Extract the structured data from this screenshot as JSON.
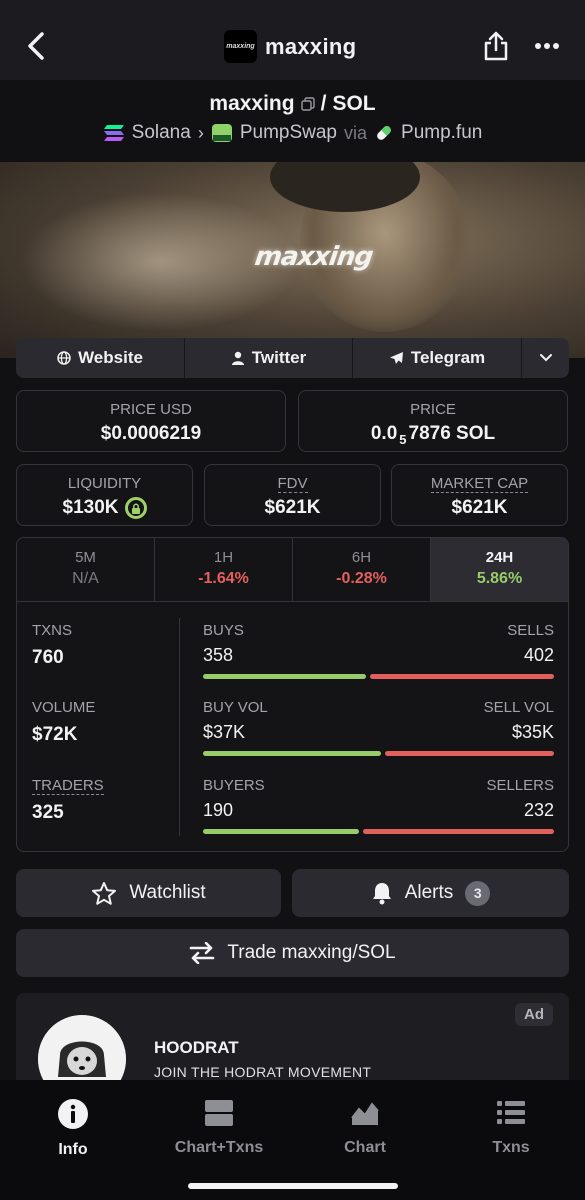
{
  "header": {
    "title": "maxxing",
    "logo_text": "maxxing",
    "back_icon": "chevron-left-icon",
    "share_icon": "share-icon",
    "more_icon": "more-horizontal-icon"
  },
  "pair": {
    "token": "maxxing",
    "separator": "/",
    "quote": "SOL",
    "chain": "Solana",
    "dex": "PumpSwap",
    "via_label": "via",
    "launchpad": "Pump.fun"
  },
  "banner": {
    "logo_text": "maxxing"
  },
  "links": {
    "website": "Website",
    "twitter": "Twitter",
    "telegram": "Telegram"
  },
  "price": {
    "usd_label": "PRICE USD",
    "usd_value": "$0.0006219",
    "native_label": "PRICE",
    "native_prefix": "0.0",
    "native_zeros": "5",
    "native_rest": "7876 SOL"
  },
  "metrics": {
    "liquidity_label": "LIQUIDITY",
    "liquidity_value": "$130K",
    "fdv_label": "FDV",
    "fdv_value": "$621K",
    "mcap_label": "MARKET CAP",
    "mcap_value": "$621K"
  },
  "timeframes": [
    {
      "label": "5M",
      "value": "N/A"
    },
    {
      "label": "1H",
      "value": "-1.64%"
    },
    {
      "label": "6H",
      "value": "-0.28%"
    },
    {
      "label": "24H",
      "value": "5.86%"
    }
  ],
  "stats": {
    "txns_label": "TXNS",
    "txns_value": "760",
    "volume_label": "VOLUME",
    "volume_value": "$72K",
    "traders_label": "TRADERS",
    "traders_value": "325",
    "buys_label": "BUYS",
    "buys_value": "358",
    "sells_label": "SELLS",
    "sells_value": "402",
    "buy_vol_label": "BUY VOL",
    "buy_vol_value": "$37K",
    "sell_vol_label": "SELL VOL",
    "sell_vol_value": "$35K",
    "buyers_label": "BUYERS",
    "buyers_value": "190",
    "sellers_label": "SELLERS",
    "sellers_value": "232",
    "buys_fraction": 0.471,
    "buy_vol_fraction": 0.514,
    "buyers_fraction": 0.45
  },
  "actions": {
    "watchlist": "Watchlist",
    "alerts": "Alerts",
    "alerts_count": "3",
    "trade": "Trade maxxing/SOL"
  },
  "ad": {
    "tag": "Ad",
    "title": "HOODRAT",
    "subtitle": "JOIN THE HODRAT MOVEMENT"
  },
  "bottom_nav": [
    {
      "label": "Info",
      "icon": "info-icon"
    },
    {
      "label": "Chart+Txns",
      "icon": "split-layout-icon"
    },
    {
      "label": "Chart",
      "icon": "area-chart-icon"
    },
    {
      "label": "Txns",
      "icon": "list-icon"
    }
  ],
  "colors": {
    "positive": "#98cc6a",
    "negative": "#e2605c",
    "background": "#111114",
    "panel": "#2a2a30"
  }
}
